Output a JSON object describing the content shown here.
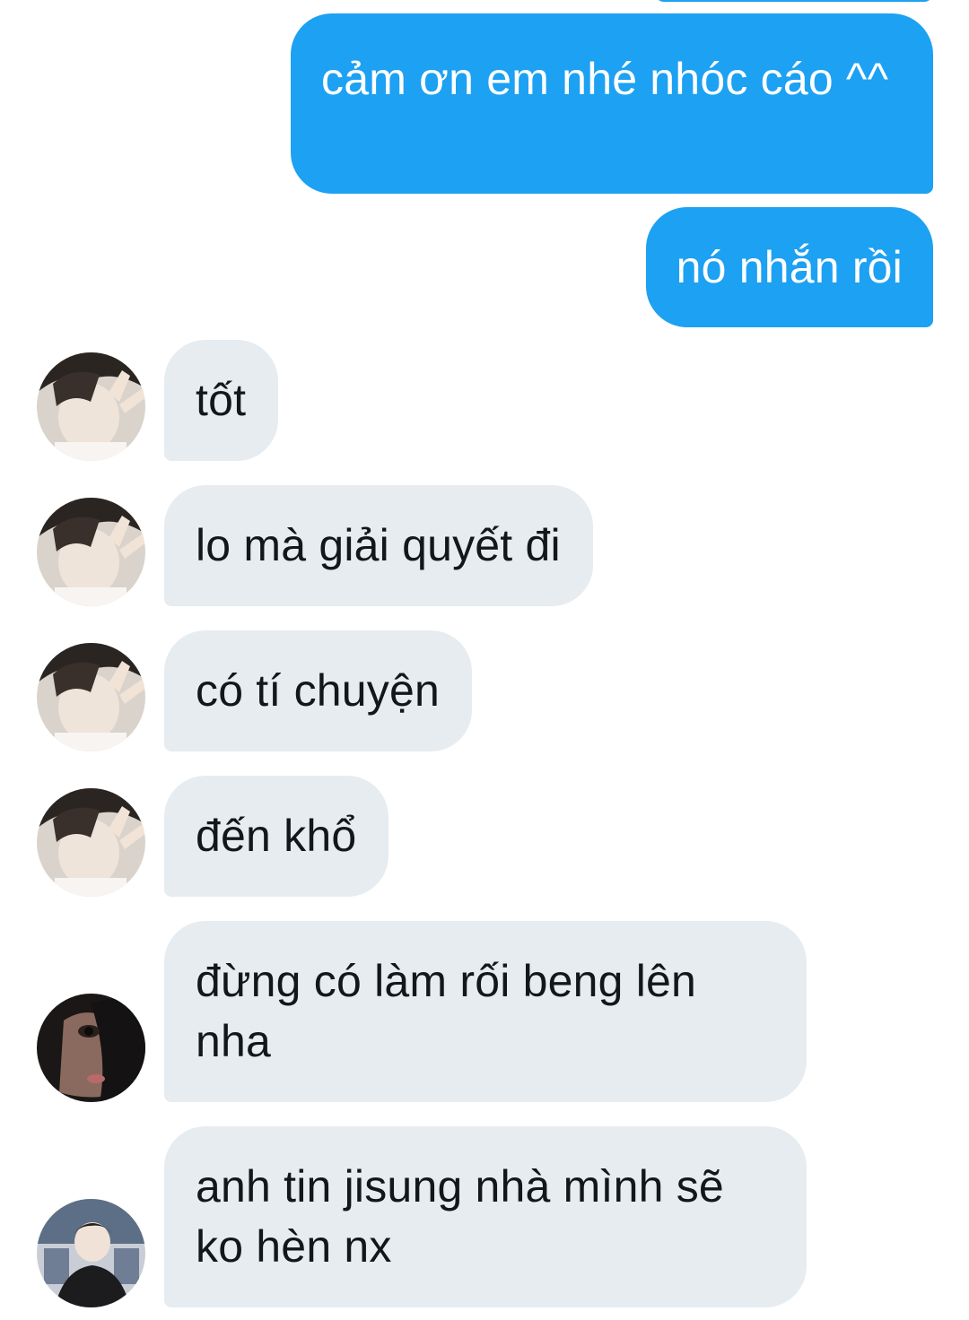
{
  "conversation": {
    "messages": [
      {
        "direction": "sent",
        "text": "cảm ơn em nhé nhóc cáo ^^"
      },
      {
        "direction": "sent",
        "text": "nó nhắn rồi"
      },
      {
        "direction": "received",
        "sender_avatar": "avatar-peace-sign",
        "text": "tốt"
      },
      {
        "direction": "received",
        "sender_avatar": "avatar-peace-sign",
        "text": "lo mà giải quyết đi"
      },
      {
        "direction": "received",
        "sender_avatar": "avatar-peace-sign",
        "text": "có tí chuyện"
      },
      {
        "direction": "received",
        "sender_avatar": "avatar-peace-sign",
        "text": "đến khổ"
      },
      {
        "direction": "received",
        "sender_avatar": "avatar-dark-portrait",
        "text": "đừng có làm rối beng lên nha"
      },
      {
        "direction": "received",
        "sender_avatar": "avatar-photo-booth",
        "text": "anh tin jisung nhà mình sẽ ko hèn nx"
      }
    ]
  },
  "colors": {
    "sent_bubble": "#1da1f2",
    "received_bubble": "#e6ecf0",
    "received_text": "#14171a",
    "sent_text": "#ffffff"
  }
}
